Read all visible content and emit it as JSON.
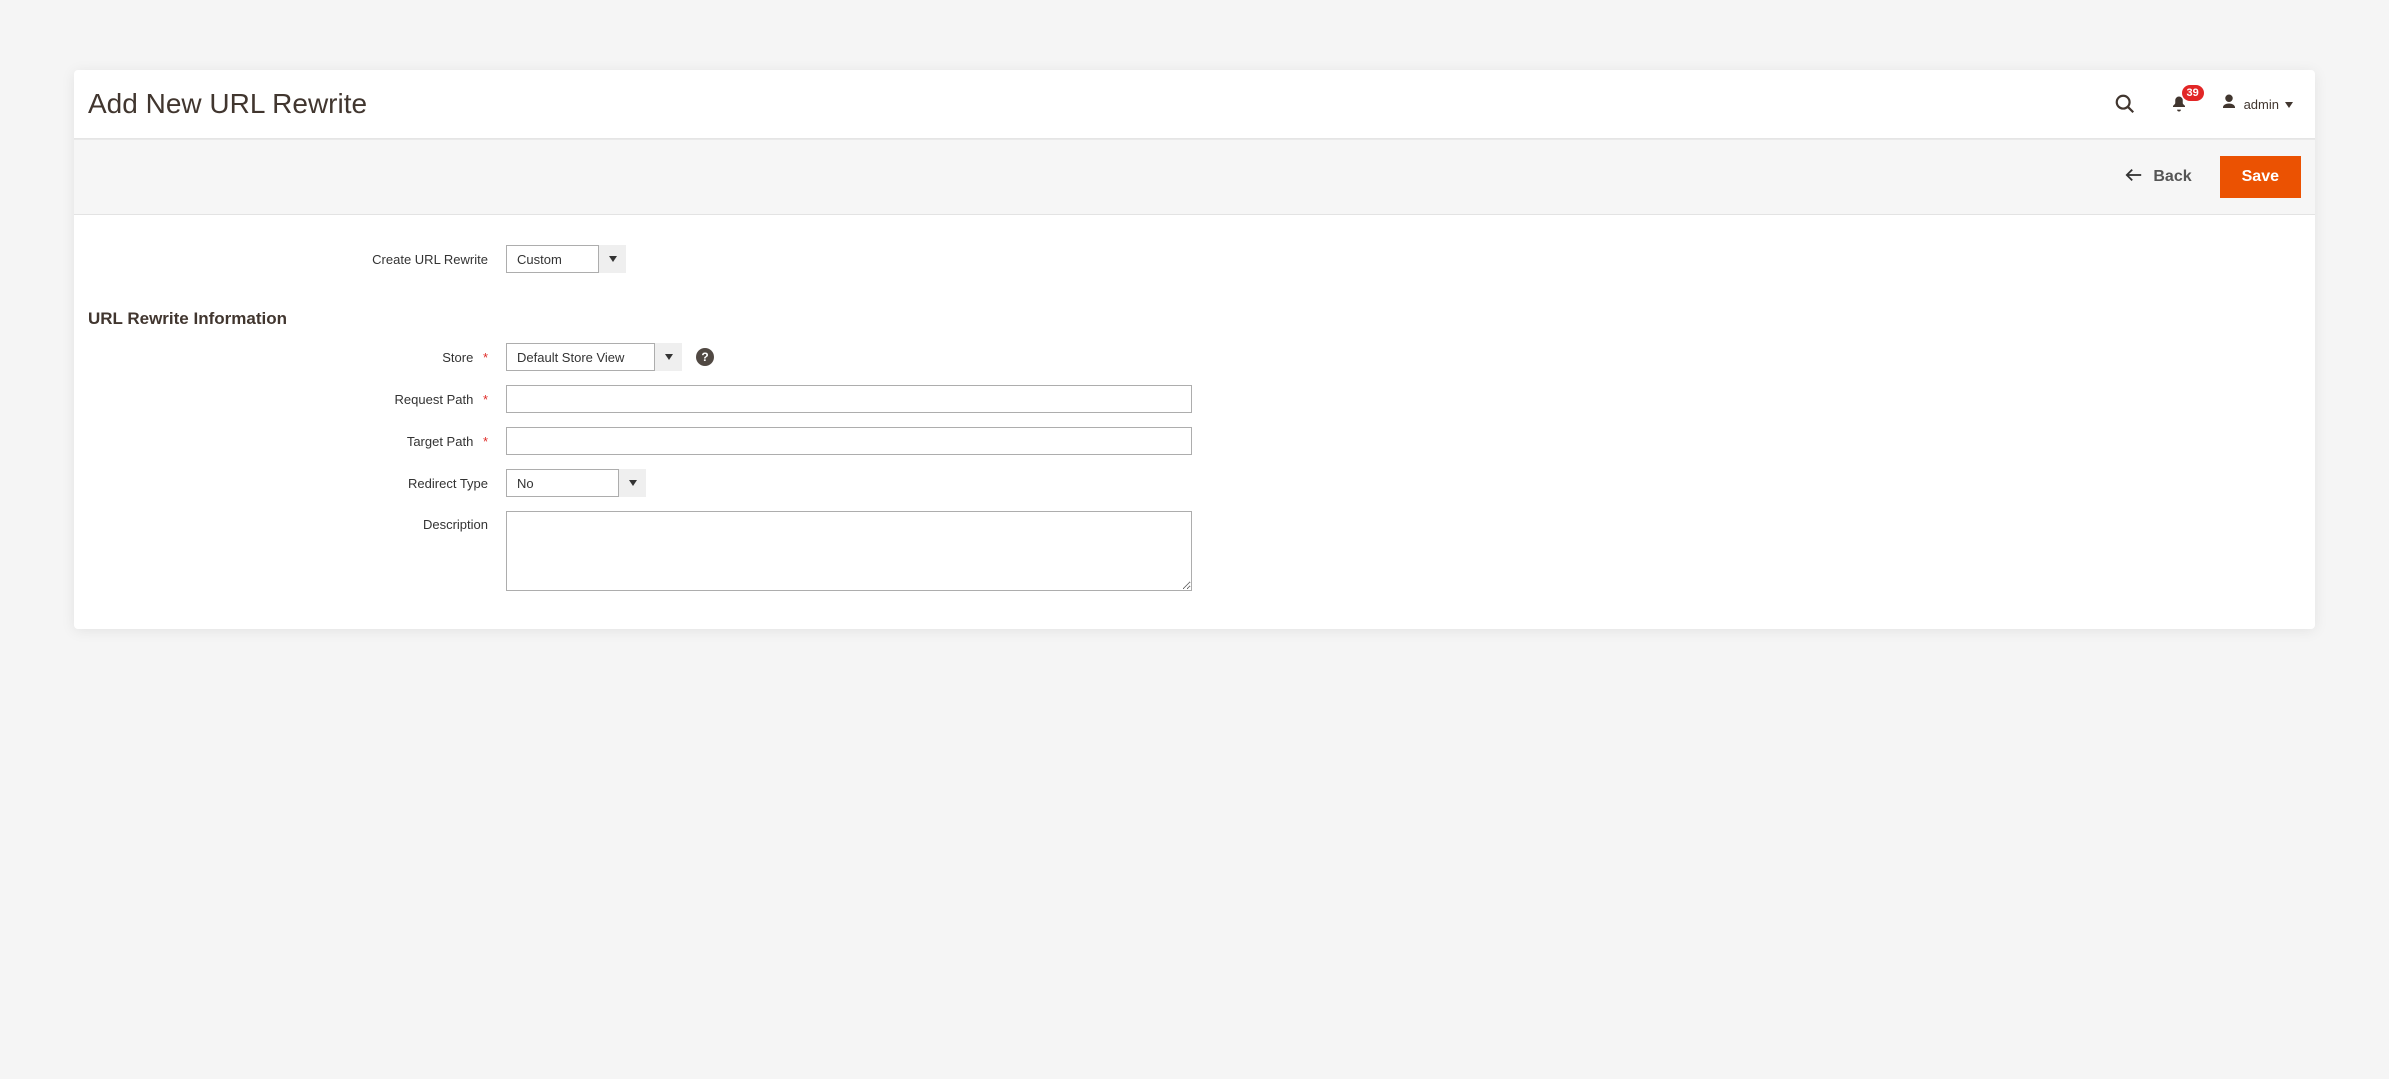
{
  "header": {
    "page_title": "Add New URL Rewrite",
    "user_name": "admin",
    "notification_count": "39"
  },
  "actions": {
    "back_label": "Back",
    "save_label": "Save"
  },
  "top": {
    "create_label": "Create URL Rewrite",
    "create_value": "Custom"
  },
  "section_title": "URL Rewrite Information",
  "fields": {
    "store": {
      "label": "Store",
      "value": "Default Store View"
    },
    "request_path": {
      "label": "Request Path",
      "value": ""
    },
    "target_path": {
      "label": "Target Path",
      "value": ""
    },
    "redirect_type": {
      "label": "Redirect Type",
      "value": "No"
    },
    "description": {
      "label": "Description",
      "value": ""
    }
  },
  "tooltip_glyph": "?"
}
